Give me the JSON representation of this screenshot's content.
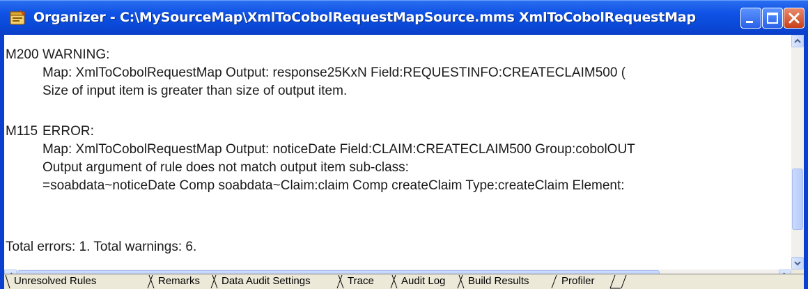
{
  "window": {
    "title": "Organizer - C:\\MySourceMap\\XmlToCobolRequestMapSource.mms XmlToCobolRequestMap"
  },
  "icons": {
    "app": "organizer-app-icon",
    "minimize": "minimize-icon",
    "maximize": "maximize-icon",
    "close": "close-icon",
    "scroll_up": "arrow-up-icon",
    "scroll_down": "arrow-down-icon",
    "scroll_left": "arrow-left-icon",
    "scroll_right": "arrow-right-icon"
  },
  "colors": {
    "titlebar": "#0a4ad8",
    "title_text": "#ffffff",
    "close_button": "#c8401a",
    "scrollbar_thumb": "#c1d3fb"
  },
  "messages": {
    "m200": {
      "code": "M200",
      "severity": "WARNING:",
      "detail": "Map: XmlToCobolRequestMap   Output: response25KxN Field:REQUESTINFO:CREATECLAIM500 (",
      "note": "Size of input item is greater than size of output item."
    },
    "m115": {
      "code": "M115",
      "severity": "ERROR:",
      "detail": "Map: XmlToCobolRequestMap   Output: noticeDate Field:CLAIM:CREATECLAIM500 Group:cobolOUT",
      "note": "Output argument of rule does not match output item sub-class:",
      "path": "=soabdata~noticeDate Comp soabdata~Claim:claim Comp createClaim Type:createClaim Element:"
    },
    "totals": "Total errors: 1.   Total warnings: 6."
  },
  "tabs": [
    {
      "label": "Unresolved Rules"
    },
    {
      "label": "Remarks"
    },
    {
      "label": "Data Audit Settings"
    },
    {
      "label": "Trace"
    },
    {
      "label": "Audit Log"
    },
    {
      "label": "Build Results",
      "active": true
    },
    {
      "label": "Profiler"
    }
  ]
}
